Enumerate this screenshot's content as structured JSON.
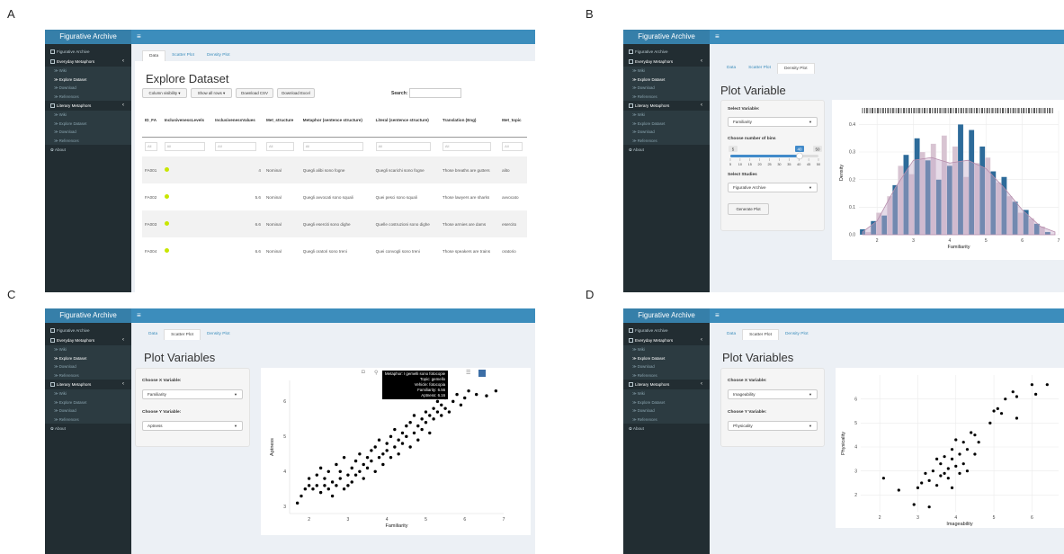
{
  "panel_letters": [
    "A",
    "B",
    "C",
    "D"
  ],
  "app": {
    "brand": "Figurative Archive",
    "hamburger": "≡",
    "sidebar": {
      "home": "Figurative Archive",
      "everyday": "Everyday Metaphors",
      "everyday_sub": [
        "≫ Wiki",
        "≫ Explore Dataset",
        "≫ Download",
        "≫ References"
      ],
      "literary": "Literary Metaphors",
      "literary_sub": [
        "≫ Wiki",
        "≫ Explore Dataset",
        "≫ Download",
        "≫ References"
      ],
      "about": "About",
      "chevron": "‹"
    },
    "tabs": [
      "Data",
      "Scatter Plot",
      "Density Plot"
    ]
  },
  "panel_a": {
    "title": "Explore Dataset",
    "buttons": [
      "Column visibility ▾",
      "Show all rows ▾",
      "Download CSV",
      "Download Excel"
    ],
    "search_label": "Search:",
    "columns": [
      "ID_FA",
      "InclusivenessLevels",
      "InclusivenessValues",
      "Met_structure",
      "Metaphor (sentence structure)",
      "Literal (sentence structure)",
      "Translation (Eng)",
      "Met_topic"
    ],
    "filter": "All",
    "rows": [
      {
        "id": "FA001",
        "value": "4",
        "structure": "Nominal",
        "metaphor": "Quegli alibi sono fogne",
        "literal": "Quegli scarichi sono fogne",
        "translation": "Those breaths are gutters",
        "topic": "alito"
      },
      {
        "id": "FA002",
        "value": "5.6",
        "structure": "Nominal",
        "metaphor": "Quegli avvocati sono squali",
        "literal": "Quei pesci sono squali",
        "translation": "Those lawyers are sharks",
        "topic": "avvocato"
      },
      {
        "id": "FA003",
        "value": "6.6",
        "structure": "Nominal",
        "metaphor": "Quegli eserciti sono dighe",
        "literal": "Quelle costruzioni sono dighe",
        "translation": "Those armies are dams",
        "topic": "esercito"
      },
      {
        "id": "FA004",
        "value": "6.6",
        "structure": "Nominal",
        "metaphor": "Quegli oratori sono treni",
        "literal": "Quei convogli sono treni",
        "translation": "Those speakers are trains",
        "topic": "oratorio"
      }
    ]
  },
  "panel_b": {
    "title": "Plot Variable",
    "select_variable_label": "Select Variable:",
    "select_variable_value": "Familiarity",
    "bins_label": "Choose number of bins",
    "bins_min": "5",
    "bins_max": "50",
    "bins_value": "40",
    "slider_ticks": [
      "5",
      "10",
      "15",
      "20",
      "25",
      "30",
      "35",
      "40",
      "45",
      "50"
    ],
    "studies_label": "Select Studies",
    "studies_value": "Figurative Archive",
    "generate_button": "Generate Plot",
    "chart_data": {
      "type": "bar",
      "xlabel": "Familiarity",
      "ylabel": "Density",
      "xlim": [
        1.5,
        7
      ],
      "ylim": [
        0,
        0.45
      ],
      "x_ticks": [
        "2",
        "3",
        "4",
        "5",
        "6",
        "7"
      ],
      "y_ticks": [
        "0.0",
        "0.1",
        "0.2",
        "0.3",
        "0.4"
      ],
      "bin_centers": [
        1.6,
        1.75,
        1.9,
        2.05,
        2.2,
        2.35,
        2.5,
        2.65,
        2.8,
        2.95,
        3.1,
        3.25,
        3.4,
        3.55,
        3.7,
        3.85,
        4.0,
        4.15,
        4.3,
        4.45,
        4.6,
        4.75,
        4.9,
        5.05,
        5.2,
        5.35,
        5.5,
        5.65,
        5.8,
        5.95,
        6.1,
        6.25,
        6.4,
        6.55,
        6.7
      ],
      "densities": [
        0.02,
        0.01,
        0.05,
        0.08,
        0.07,
        0.14,
        0.18,
        0.25,
        0.29,
        0.22,
        0.35,
        0.3,
        0.27,
        0.33,
        0.2,
        0.36,
        0.25,
        0.32,
        0.4,
        0.21,
        0.38,
        0.26,
        0.32,
        0.28,
        0.23,
        0.19,
        0.21,
        0.14,
        0.12,
        0.08,
        0.09,
        0.06,
        0.04,
        0.03,
        0.01
      ],
      "density_curve": [
        [
          1.6,
          0.01
        ],
        [
          2.0,
          0.05
        ],
        [
          2.5,
          0.17
        ],
        [
          3.0,
          0.27
        ],
        [
          3.5,
          0.28
        ],
        [
          4.0,
          0.26
        ],
        [
          4.5,
          0.27
        ],
        [
          5.0,
          0.24
        ],
        [
          5.5,
          0.17
        ],
        [
          6.0,
          0.09
        ],
        [
          6.5,
          0.03
        ],
        [
          6.9,
          0.01
        ]
      ]
    }
  },
  "panel_c": {
    "title": "Plot Variables",
    "x_label": "Choose X Variable:",
    "x_value": "Familiarity",
    "y_label": "Choose Y Variable:",
    "y_value": "Aptness",
    "tooltip": [
      "Metaphor: I gemelli sono fotocopie",
      "Topic: gemello",
      "Vehicle: fotocopia",
      "Familiarity: 6.56",
      "Aptness: 6.16"
    ],
    "chart_data": {
      "type": "scatter",
      "xlabel": "Familiarity",
      "ylabel": "Aptness",
      "xlim": [
        1.5,
        7
      ],
      "ylim": [
        2.8,
        6.6
      ],
      "x_ticks": [
        "2",
        "3",
        "4",
        "5",
        "6",
        "7"
      ],
      "y_ticks": [
        "3",
        "4",
        "5",
        "6"
      ],
      "points": [
        [
          1.7,
          3.1
        ],
        [
          1.8,
          3.3
        ],
        [
          1.9,
          3.5
        ],
        [
          2.0,
          3.6
        ],
        [
          2.0,
          3.8
        ],
        [
          2.1,
          3.5
        ],
        [
          2.2,
          3.6
        ],
        [
          2.2,
          3.9
        ],
        [
          2.3,
          3.4
        ],
        [
          2.3,
          4.1
        ],
        [
          2.4,
          3.6
        ],
        [
          2.4,
          3.8
        ],
        [
          2.5,
          3.5
        ],
        [
          2.5,
          4.0
        ],
        [
          2.6,
          3.7
        ],
        [
          2.6,
          3.3
        ],
        [
          2.7,
          3.6
        ],
        [
          2.7,
          4.2
        ],
        [
          2.8,
          3.8
        ],
        [
          2.8,
          4.0
        ],
        [
          2.9,
          3.5
        ],
        [
          2.9,
          4.4
        ],
        [
          3.0,
          3.9
        ],
        [
          3.0,
          3.6
        ],
        [
          3.1,
          4.1
        ],
        [
          3.1,
          3.7
        ],
        [
          3.2,
          4.3
        ],
        [
          3.2,
          3.9
        ],
        [
          3.3,
          4.0
        ],
        [
          3.3,
          4.5
        ],
        [
          3.4,
          4.2
        ],
        [
          3.4,
          3.8
        ],
        [
          3.5,
          4.4
        ],
        [
          3.5,
          4.1
        ],
        [
          3.6,
          4.6
        ],
        [
          3.6,
          4.3
        ],
        [
          3.7,
          4.0
        ],
        [
          3.7,
          4.7
        ],
        [
          3.8,
          4.4
        ],
        [
          3.8,
          4.9
        ],
        [
          3.9,
          4.5
        ],
        [
          3.9,
          4.2
        ],
        [
          4.0,
          4.8
        ],
        [
          4.0,
          4.6
        ],
        [
          4.1,
          5.0
        ],
        [
          4.1,
          4.4
        ],
        [
          4.2,
          4.7
        ],
        [
          4.2,
          5.2
        ],
        [
          4.3,
          4.9
        ],
        [
          4.3,
          4.5
        ],
        [
          4.4,
          5.1
        ],
        [
          4.4,
          4.8
        ],
        [
          4.5,
          5.3
        ],
        [
          4.5,
          5.0
        ],
        [
          4.6,
          4.7
        ],
        [
          4.6,
          5.4
        ],
        [
          4.7,
          5.1
        ],
        [
          4.7,
          5.6
        ],
        [
          4.8,
          5.3
        ],
        [
          4.8,
          4.9
        ],
        [
          4.9,
          5.5
        ],
        [
          4.9,
          5.2
        ],
        [
          5.0,
          5.7
        ],
        [
          5.0,
          5.4
        ],
        [
          5.1,
          5.6
        ],
        [
          5.1,
          5.1
        ],
        [
          5.2,
          5.8
        ],
        [
          5.2,
          5.5
        ],
        [
          5.3,
          5.7
        ],
        [
          5.3,
          6.0
        ],
        [
          5.4,
          5.6
        ],
        [
          5.4,
          5.9
        ],
        [
          5.5,
          5.8
        ],
        [
          5.5,
          6.1
        ],
        [
          5.6,
          5.7
        ],
        [
          5.7,
          6.0
        ],
        [
          5.8,
          6.2
        ],
        [
          5.9,
          5.9
        ],
        [
          6.0,
          6.1
        ],
        [
          6.1,
          6.3
        ],
        [
          6.3,
          6.2
        ],
        [
          6.56,
          6.16
        ],
        [
          6.8,
          6.3
        ]
      ]
    }
  },
  "panel_d": {
    "title": "Plot Variables",
    "x_label": "Choose X Variable:",
    "x_value": "Imageability",
    "y_label": "Choose Y Variable:",
    "y_value": "Physicality",
    "chart_data": {
      "type": "scatter",
      "xlabel": "Imageability",
      "ylabel": "Physicality",
      "xlim": [
        1.5,
        6.7
      ],
      "ylim": [
        1.3,
        7.0
      ],
      "x_ticks": [
        "2",
        "3",
        "4",
        "5",
        "6"
      ],
      "y_ticks": [
        "2",
        "3",
        "4",
        "5",
        "6"
      ],
      "points": [
        [
          2.1,
          2.7
        ],
        [
          2.5,
          2.2
        ],
        [
          2.9,
          1.6
        ],
        [
          3.0,
          2.3
        ],
        [
          3.1,
          2.5
        ],
        [
          3.2,
          2.9
        ],
        [
          3.3,
          2.6
        ],
        [
          3.3,
          1.5
        ],
        [
          3.4,
          3.0
        ],
        [
          3.5,
          3.5
        ],
        [
          3.5,
          2.4
        ],
        [
          3.6,
          2.8
        ],
        [
          3.6,
          3.3
        ],
        [
          3.7,
          2.9
        ],
        [
          3.7,
          3.6
        ],
        [
          3.8,
          3.1
        ],
        [
          3.8,
          2.7
        ],
        [
          3.9,
          3.5
        ],
        [
          3.9,
          3.9
        ],
        [
          3.9,
          2.3
        ],
        [
          4.0,
          3.2
        ],
        [
          4.0,
          4.3
        ],
        [
          4.1,
          2.9
        ],
        [
          4.1,
          3.7
        ],
        [
          4.2,
          3.3
        ],
        [
          4.2,
          4.2
        ],
        [
          4.3,
          3.9
        ],
        [
          4.3,
          3.0
        ],
        [
          4.4,
          4.6
        ],
        [
          4.5,
          4.5
        ],
        [
          4.5,
          3.7
        ],
        [
          4.6,
          4.2
        ],
        [
          4.9,
          5.0
        ],
        [
          5.0,
          5.5
        ],
        [
          5.1,
          5.6
        ],
        [
          5.2,
          5.4
        ],
        [
          5.3,
          6.0
        ],
        [
          5.5,
          6.3
        ],
        [
          5.6,
          5.2
        ],
        [
          5.6,
          6.1
        ],
        [
          6.0,
          6.6
        ],
        [
          6.1,
          6.2
        ],
        [
          6.4,
          6.6
        ]
      ]
    }
  }
}
